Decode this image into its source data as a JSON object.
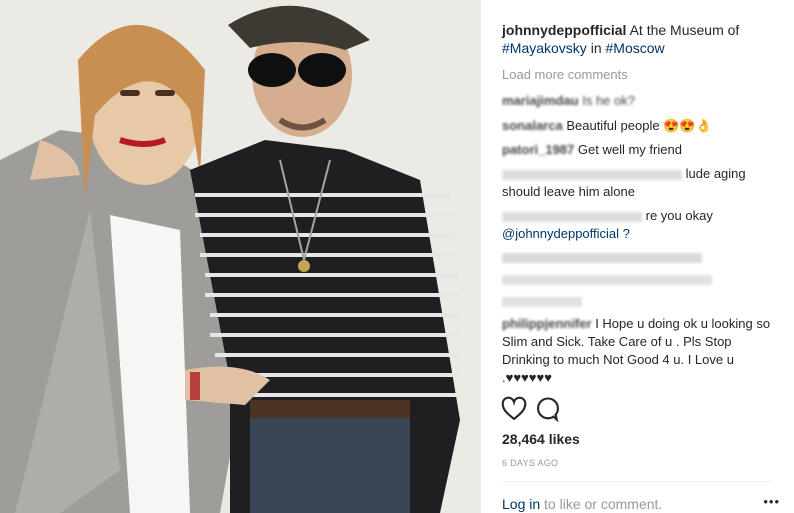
{
  "post": {
    "username": "johnnydeppofficial",
    "caption_text": "At the Museum of",
    "hashtag_1": "#Mayakovsky",
    "caption_in": "in",
    "hashtag_2": "#Moscow"
  },
  "load_more": "Load more comments",
  "comments": [
    {
      "user": "mariajimdau",
      "text": "Is he ok?"
    },
    {
      "user": "sonalarca",
      "text": "Beautiful people 😍😍👌"
    },
    {
      "user": "patori_1987",
      "text": "Get well my friend"
    },
    {
      "user": "",
      "text": "should leave him alone",
      "partial": "lude aging"
    },
    {
      "user": "",
      "text": "re you okay",
      "mention": "@johnnydeppofficial ?"
    },
    {
      "user": "philippjennifer",
      "text": "I Hope u doing ok u looking so Slim and Sick. Take Care of u . Pls Stop Drinking to much Not Good 4 u. I Love u .♥♥♥♥♥♥"
    }
  ],
  "likes": "28,464 likes",
  "timestamp": "6 DAYS AGO",
  "login": {
    "link": "Log in",
    "rest": "to like or comment."
  },
  "more": "•••",
  "icons": {
    "like": "heart-icon",
    "comment": "comment-icon",
    "more": "more-options-icon"
  }
}
